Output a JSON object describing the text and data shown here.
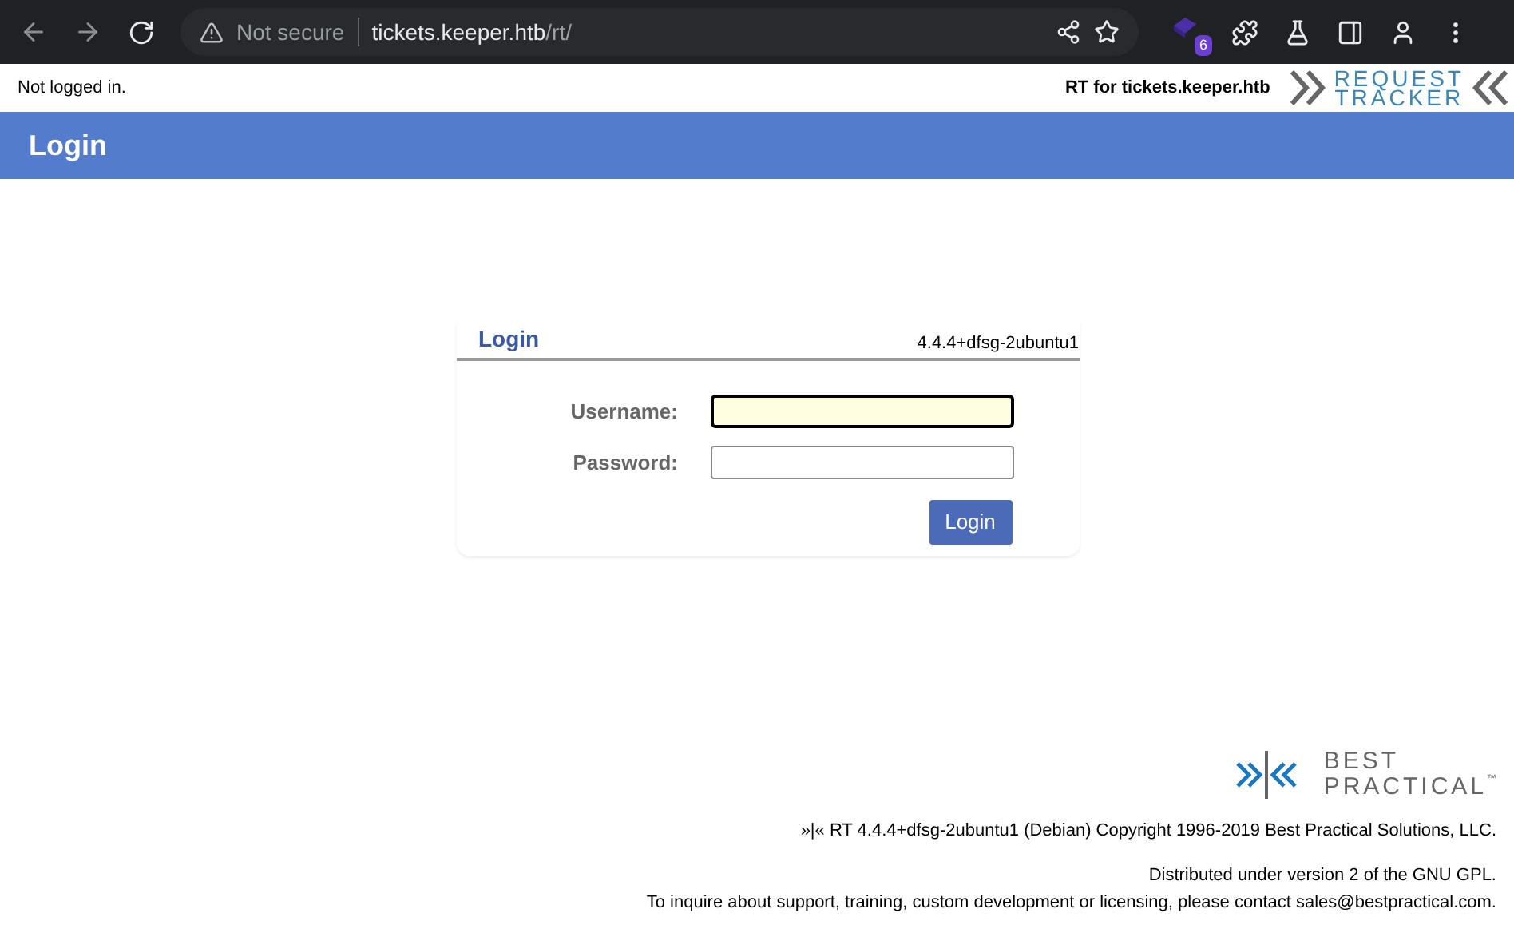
{
  "browser": {
    "security": "Not secure",
    "url_host": "tickets.keeper.htb",
    "url_path": "/rt/",
    "extension_badge": "6"
  },
  "header": {
    "status": "Not logged in.",
    "site": "RT for tickets.keeper.htb",
    "logo_top": "REQUEST",
    "logo_bottom": "TRACKER"
  },
  "title_bar": {
    "title": "Login"
  },
  "login": {
    "title": "Login",
    "version": "4.4.4+dfsg-2ubuntu1",
    "fields": [
      {
        "label": "Username:",
        "focused": true
      },
      {
        "label": "Password:",
        "focused": false
      }
    ],
    "button": "Login"
  },
  "footer": {
    "logo_top": "BEST",
    "logo_bottom": "PRACTICAL",
    "logo_tm": "™",
    "copyright": "»|« RT 4.4.4+dfsg-2ubuntu1 (Debian) Copyright 1996-2019 Best Practical Solutions, LLC.",
    "license": "Distributed under version 2 of the GNU GPL.",
    "contact": "To inquire about support, training, custom development or licensing, please contact sales@bestpractical.com."
  }
}
